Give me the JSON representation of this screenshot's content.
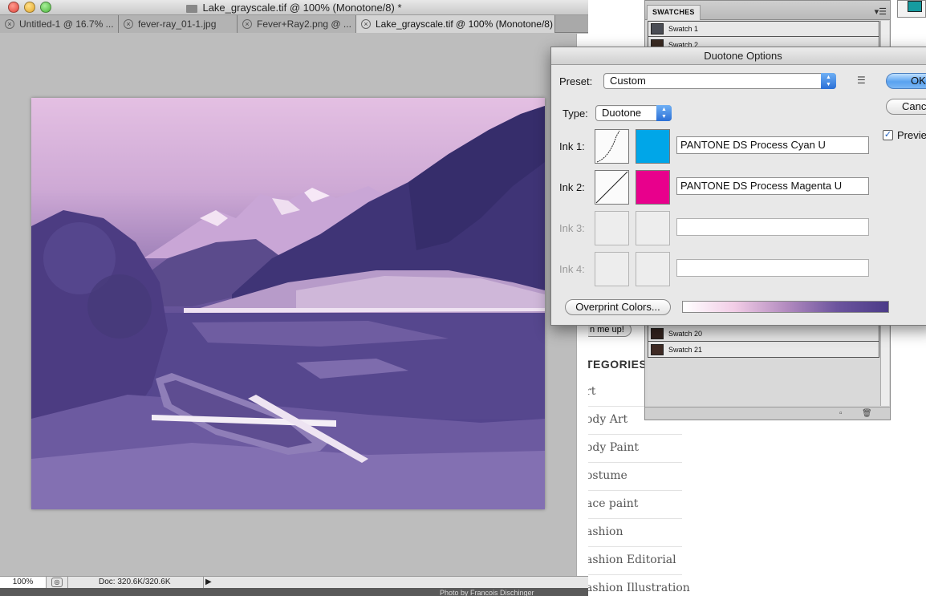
{
  "window": {
    "title": "Lake_grayscale.tif @ 100% (Monotone/8) *"
  },
  "tabs": [
    {
      "label": "Untitled-1 @ 16.7% ..."
    },
    {
      "label": "fever-ray_01-1.jpg"
    },
    {
      "label": "Fever+Ray2.png @ ..."
    },
    {
      "label": "Lake_grayscale.tif @ 100% (Monotone/8) *"
    }
  ],
  "status": {
    "zoom": "100%",
    "doc_info": "Doc: 320.6K/320.6K"
  },
  "photo_credit": "Photo by Francois Dischinger",
  "swatches_panel": {
    "tab_label": "SWATCHES",
    "items": [
      {
        "name": "Swatch 1",
        "color": "#4a4d55"
      },
      {
        "name": "Swatch 2",
        "color": "#3a2a22"
      },
      {
        "name": "Swatch 20",
        "color": "#33241f"
      },
      {
        "name": "Swatch 21",
        "color": "#3f2a24"
      }
    ]
  },
  "webpage": {
    "signup_button": "n me up!",
    "categories_title": "TEGORIES",
    "categories": [
      "rt",
      "ody Art",
      "ody Paint",
      "ostume",
      "ace paint",
      "ashion",
      "ashion Editorial",
      "ashion Illustration"
    ]
  },
  "dialog": {
    "title": "Duotone Options",
    "preset_label": "Preset:",
    "preset_value": "Custom",
    "type_label": "Type:",
    "type_value": "Duotone",
    "ok_label": "OK",
    "cancel_label": "Canc",
    "preview_label": "Previe",
    "preview_checked": true,
    "overprint_label": "Overprint Colors...",
    "inks": [
      {
        "label": "Ink 1:",
        "name": "PANTONE DS Process Cyan U",
        "color": "#00a6e8",
        "enabled": true
      },
      {
        "label": "Ink 2:",
        "name": "PANTONE DS Process Magenta U",
        "color": "#e8008c",
        "enabled": true
      },
      {
        "label": "Ink 3:",
        "name": "",
        "color": "",
        "enabled": false
      },
      {
        "label": "Ink 4:",
        "name": "",
        "color": "",
        "enabled": false
      }
    ]
  }
}
